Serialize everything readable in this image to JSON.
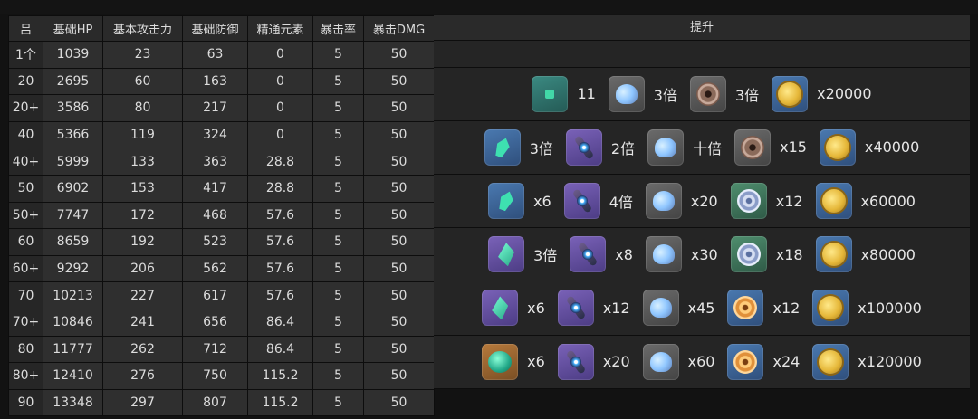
{
  "title": "",
  "table": {
    "headers": [
      "吕",
      "基础HP",
      "基本攻击力",
      "基础防御",
      "精通元素",
      "暴击率",
      "暴击DMG"
    ],
    "rows": [
      [
        "1个",
        "1039",
        "23",
        "63",
        "0",
        "5",
        "50"
      ],
      [
        "20",
        "2695",
        "60",
        "163",
        "0",
        "5",
        "50"
      ],
      [
        "20+",
        "3586",
        "80",
        "217",
        "0",
        "5",
        "50"
      ],
      [
        "40",
        "5366",
        "119",
        "324",
        "0",
        "5",
        "50"
      ],
      [
        "40+",
        "5999",
        "133",
        "363",
        "28.8",
        "5",
        "50"
      ],
      [
        "50",
        "6902",
        "153",
        "417",
        "28.8",
        "5",
        "50"
      ],
      [
        "50+",
        "7747",
        "172",
        "468",
        "57.6",
        "5",
        "50"
      ],
      [
        "60",
        "8659",
        "192",
        "523",
        "57.6",
        "5",
        "50"
      ],
      [
        "60+",
        "9292",
        "206",
        "562",
        "57.6",
        "5",
        "50"
      ],
      [
        "70",
        "10213",
        "227",
        "617",
        "57.6",
        "5",
        "50"
      ],
      [
        "70+",
        "10846",
        "241",
        "656",
        "86.4",
        "5",
        "50"
      ],
      [
        "80",
        "11777",
        "262",
        "712",
        "86.4",
        "5",
        "50"
      ],
      [
        "80+",
        "12410",
        "276",
        "750",
        "115.2",
        "5",
        "50"
      ],
      [
        "90",
        "13348",
        "297",
        "807",
        "115.2",
        "5",
        "50"
      ]
    ]
  },
  "upgrade": {
    "header": "提升",
    "groups": [
      [
        {
          "icon": "gem-fragment-icon",
          "qty": "11"
        },
        {
          "icon": "blue-flower-icon",
          "qty": "3倍"
        },
        {
          "icon": "shell-icon",
          "qty": "3倍"
        },
        {
          "icon": "gold-coin-icon",
          "qty": "x20000"
        }
      ],
      [
        {
          "icon": "crystal-sliver-icon",
          "qty": "3倍"
        },
        {
          "icon": "rod-icon",
          "qty": "2倍"
        },
        {
          "icon": "blue-flower-icon",
          "qty": "十倍"
        },
        {
          "icon": "shell-icon",
          "qty": "x15"
        },
        {
          "icon": "gold-coin-icon",
          "qty": "x40000"
        }
      ],
      [
        {
          "icon": "crystal-sliver-icon",
          "qty": "x6"
        },
        {
          "icon": "rod-icon",
          "qty": "4倍"
        },
        {
          "icon": "blue-flower-icon",
          "qty": "x20"
        },
        {
          "icon": "swirl-shell-icon",
          "qty": "x12"
        },
        {
          "icon": "gold-coin-icon",
          "qty": "x60000"
        }
      ],
      [
        {
          "icon": "crystal-fragment-icon",
          "qty": "3倍"
        },
        {
          "icon": "rod-icon",
          "qty": "x8"
        },
        {
          "icon": "blue-flower-icon",
          "qty": "x30"
        },
        {
          "icon": "swirl-shell-icon",
          "qty": "x18"
        },
        {
          "icon": "gold-coin-icon",
          "qty": "x80000"
        }
      ],
      [
        {
          "icon": "crystal-fragment-icon",
          "qty": "x6"
        },
        {
          "icon": "rod-icon",
          "qty": "x12"
        },
        {
          "icon": "blue-flower-icon",
          "qty": "x45"
        },
        {
          "icon": "gold-swirl-shell-icon",
          "qty": "x12"
        },
        {
          "icon": "gold-coin-icon",
          "qty": "x100000"
        }
      ],
      [
        {
          "icon": "crystal-gemstone-icon",
          "qty": "x6"
        },
        {
          "icon": "rod-icon",
          "qty": "x20"
        },
        {
          "icon": "blue-flower-icon",
          "qty": "x60"
        },
        {
          "icon": "gold-swirl-shell-icon",
          "qty": "x24"
        },
        {
          "icon": "gold-coin-icon",
          "qty": "x120000"
        }
      ]
    ]
  }
}
